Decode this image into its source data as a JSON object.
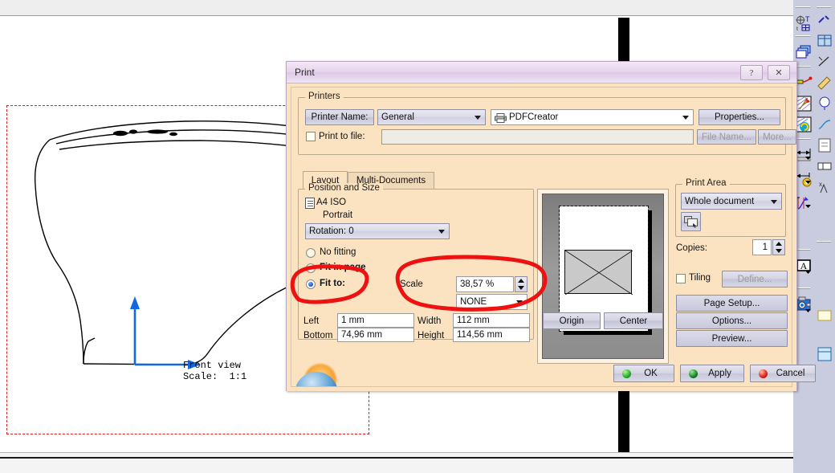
{
  "dialog": {
    "title": "Print",
    "titlebar_buttons": [
      {
        "name": "help-button",
        "glyph": "?"
      },
      {
        "name": "close-button",
        "glyph": "✕"
      }
    ],
    "printers_group": {
      "label": "Printers",
      "printer_name_button": "Printer Name:",
      "printer_profile_value": "General",
      "printer_device_value": "PDFCreator",
      "properties_button": "Properties...",
      "print_to_file_label": "Print to file:",
      "print_to_file_value": "",
      "file_name_button": "File Name...",
      "more_button": "More..."
    },
    "tabs": [
      {
        "label": "Layout",
        "active": true
      },
      {
        "label": "Multi-Documents",
        "active": false
      }
    ],
    "position_and_size": {
      "label": "Position and Size",
      "paper_name": "A4 ISO",
      "orientation": "Portrait",
      "rotation_value": "Rotation: 0",
      "fitting_options": [
        {
          "label": "No fitting",
          "selected": false
        },
        {
          "label": "Fit in page",
          "selected": false
        },
        {
          "label": "Fit to:",
          "selected": true
        }
      ],
      "scale_label": "Scale",
      "scale_value": "38,57 %",
      "scale_mode_value": "NONE",
      "left_label": "Left",
      "left_value": "1 mm",
      "bottom_label": "Bottom",
      "bottom_value": "74,96 mm",
      "width_label": "Width",
      "width_value": "112 mm",
      "height_label": "Height",
      "height_value": "114,56 mm",
      "origin_button": "Origin",
      "center_button": "Center"
    },
    "print_area": {
      "label": "Print Area",
      "area_value": "Whole document",
      "pick_area_icon": "select-area-icon",
      "copies_label": "Copies:",
      "copies_value": "1",
      "tiling_label": "Tiling",
      "tiling_checked": false,
      "define_button": "Define...",
      "page_setup_button": "Page Setup...",
      "options_button": "Options...",
      "preview_button": "Preview..."
    },
    "actions": [
      {
        "label": "OK",
        "orb": "green"
      },
      {
        "label": "Apply",
        "orb": "dgreen"
      },
      {
        "label": "Cancel",
        "orb": "red"
      }
    ]
  },
  "drawing": {
    "view_label": "Front view",
    "scale_label": "Scale:  1:1"
  },
  "annotations": {
    "highlight_color": "#ee1111",
    "marks": [
      {
        "name": "fit-to-highlight",
        "target": "Fit to: radio"
      },
      {
        "name": "scale-highlight",
        "target": "Scale field and NONE combo"
      }
    ]
  },
  "toolbar": {
    "icons": [
      {
        "name": "datum-text-icon"
      },
      {
        "name": "layers-icon"
      },
      {
        "name": "leader-line-icon"
      },
      {
        "name": "hatch-icon"
      },
      {
        "name": "spiral-hatch-icon"
      },
      {
        "name": "linear-dimension-icon"
      },
      {
        "name": "dimension-style-icon"
      },
      {
        "name": "curve-dimension-icon"
      },
      {
        "name": "text-box-icon"
      },
      {
        "name": "view-capture-icon"
      }
    ],
    "icons_right": [
      {
        "name": "link-icon"
      },
      {
        "name": "table-icon"
      },
      {
        "name": "symbol-icon"
      },
      {
        "name": "annotate-icon"
      },
      {
        "name": "balloon-icon"
      },
      {
        "name": "measure-icon"
      },
      {
        "name": "note-icon"
      },
      {
        "name": "tolerance-icon"
      },
      {
        "name": "letter-a-icon"
      },
      {
        "name": "image-icon"
      },
      {
        "name": "form-icon"
      }
    ]
  }
}
